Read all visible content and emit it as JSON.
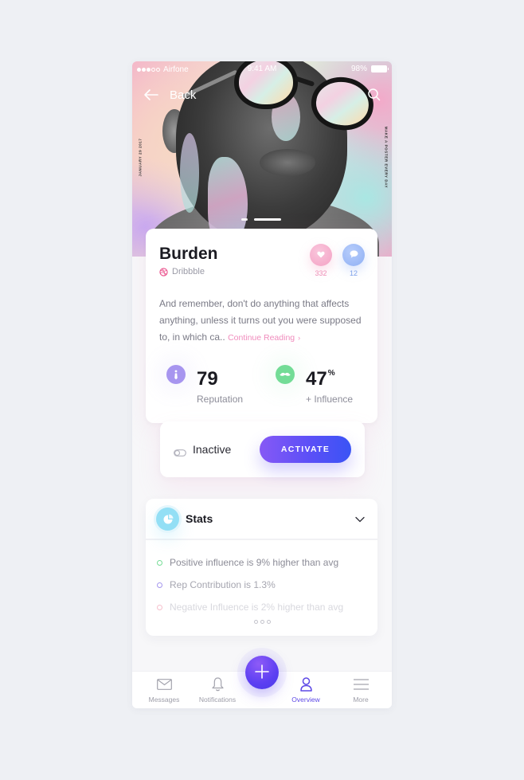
{
  "status_bar": {
    "signal_dots_on": 3,
    "signal_dots_total": 5,
    "carrier": "Airfone",
    "time": "9:41 AM",
    "battery": "98%",
    "battery_level": 0.98
  },
  "header": {
    "back_label": "Back",
    "back_icon": "arrow-left-icon",
    "search_icon": "search-icon",
    "side_text_left": "January 29 2017",
    "side_text_right": "Make a poster every day",
    "pager": {
      "count": 2,
      "active_index": 1
    }
  },
  "profile": {
    "name": "Burden",
    "source": "Dribbble",
    "source_icon": "dribbble-icon",
    "likes": {
      "icon": "heart-icon",
      "count": "332",
      "color": "#f4a1c4"
    },
    "comments": {
      "icon": "chat-bubble-icon",
      "count": "12",
      "color": "#8fb0f4"
    },
    "excerpt": "And remember, don't do anything that affects anything, unless it turns out you were supposed to, in which ca..",
    "continue_label": "Continue Reading",
    "continue_chevron": "›",
    "metrics": [
      {
        "icon": "tie-icon",
        "value": "79",
        "suffix": "",
        "label": "Reputation",
        "color": "#a795ef"
      },
      {
        "icon": "mustache-icon",
        "value": "47",
        "suffix": "%",
        "label": "+ Influence",
        "color": "#73dc96"
      }
    ]
  },
  "activation": {
    "toggle_icon": "toggle-off-icon",
    "status_label": "Inactive",
    "button_label": "ACTIVATE",
    "accent": "#5b4ff7"
  },
  "stats": {
    "title": "Stats",
    "icon": "pie-chart-icon",
    "expand_icon": "chevron-down-icon",
    "items": [
      {
        "text": "Positive influence is 9% higher than avg",
        "color": "#77dd97"
      },
      {
        "text": "Rep Contribution is 1.3%",
        "color": "#a597ee"
      },
      {
        "text": "Negative Influence is 2% higher than avg",
        "color": "#f6c0cc"
      }
    ],
    "more_icon": "more-dots-icon"
  },
  "tabbar": {
    "tabs": [
      {
        "label": "Messages",
        "icon": "envelope-icon",
        "active": false
      },
      {
        "label": "Notifications",
        "icon": "bell-icon",
        "active": false
      },
      {
        "label": "Overview",
        "icon": "user-icon",
        "active": true
      },
      {
        "label": "More",
        "icon": "menu-icon",
        "active": false
      }
    ],
    "fab_icon": "plus-icon",
    "active_color": "#5d48e6"
  }
}
